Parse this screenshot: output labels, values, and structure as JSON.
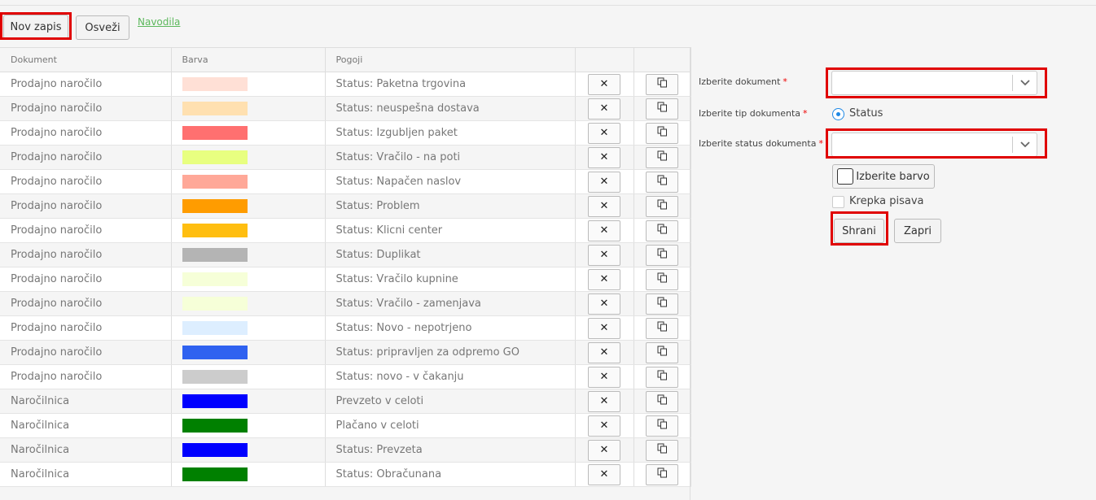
{
  "toolbar": {
    "new_label": "Nov zapis",
    "refresh_label": "Osveži",
    "help_link": "Navodila"
  },
  "table": {
    "headers": [
      "Dokument",
      "Barva",
      "Pogoji",
      "",
      ""
    ],
    "delete_glyph": "✕",
    "copy_icon": "copy-icon",
    "rows": [
      {
        "dokument": "Prodajno naročilo",
        "color": "#ffe0d6",
        "pogoji": "Status: Paketna trgovina"
      },
      {
        "dokument": "Prodajno naročilo",
        "color": "#ffe0b0",
        "pogoji": "Status: neuspešna dostava"
      },
      {
        "dokument": "Prodajno naročilo",
        "color": "#ff7070",
        "pogoji": "Status: Izgubljen paket"
      },
      {
        "dokument": "Prodajno naročilo",
        "color": "#e8ff80",
        "pogoji": "Status: Vračilo - na poti"
      },
      {
        "dokument": "Prodajno naročilo",
        "color": "#ffa898",
        "pogoji": "Status: Napačen naslov"
      },
      {
        "dokument": "Prodajno naročilo",
        "color": "#ff9c00",
        "pogoji": "Status: Problem"
      },
      {
        "dokument": "Prodajno naročilo",
        "color": "#ffbe10",
        "pogoji": "Status: Klicni center"
      },
      {
        "dokument": "Prodajno naročilo",
        "color": "#b4b4b4",
        "pogoji": "Status: Duplikat"
      },
      {
        "dokument": "Prodajno naročilo",
        "color": "#f6ffd8",
        "pogoji": "Status: Vračilo kupnine"
      },
      {
        "dokument": "Prodajno naročilo",
        "color": "#f6ffd8",
        "pogoji": "Status: Vračilo - zamenjava"
      },
      {
        "dokument": "Prodajno naročilo",
        "color": "#ddeeff",
        "pogoji": "Status: Novo - nepotrjeno"
      },
      {
        "dokument": "Prodajno naročilo",
        "color": "#2f62f0",
        "pogoji": "Status: pripravljen za odpremo GO"
      },
      {
        "dokument": "Prodajno naročilo",
        "color": "#cccccc",
        "pogoji": "Status: novo - v čakanju"
      },
      {
        "dokument": "Naročilnica",
        "color": "#0000ff",
        "pogoji": "Prevzeto v celoti"
      },
      {
        "dokument": "Naročilnica",
        "color": "#008000",
        "pogoji": "Plačano v celoti"
      },
      {
        "dokument": "Naročilnica",
        "color": "#0000ff",
        "pogoji": "Status: Prevzeta"
      },
      {
        "dokument": "Naročilnica",
        "color": "#008000",
        "pogoji": "Status: Obračunana"
      }
    ]
  },
  "form": {
    "doc_label": "Izberite dokument",
    "doc_value": "",
    "type_label": "Izberite tip dokumenta",
    "type_option": "Status",
    "status_label": "Izberite status dokumenta",
    "status_value": "",
    "color_button": "Izberite barvo",
    "bold_label": "Krepka pisava",
    "save_label": "Shrani",
    "close_label": "Zapri",
    "required_mark": "*"
  },
  "colors": {
    "highlight": "#e00000",
    "link": "#5cb85c",
    "radio": "#1e88e5"
  }
}
